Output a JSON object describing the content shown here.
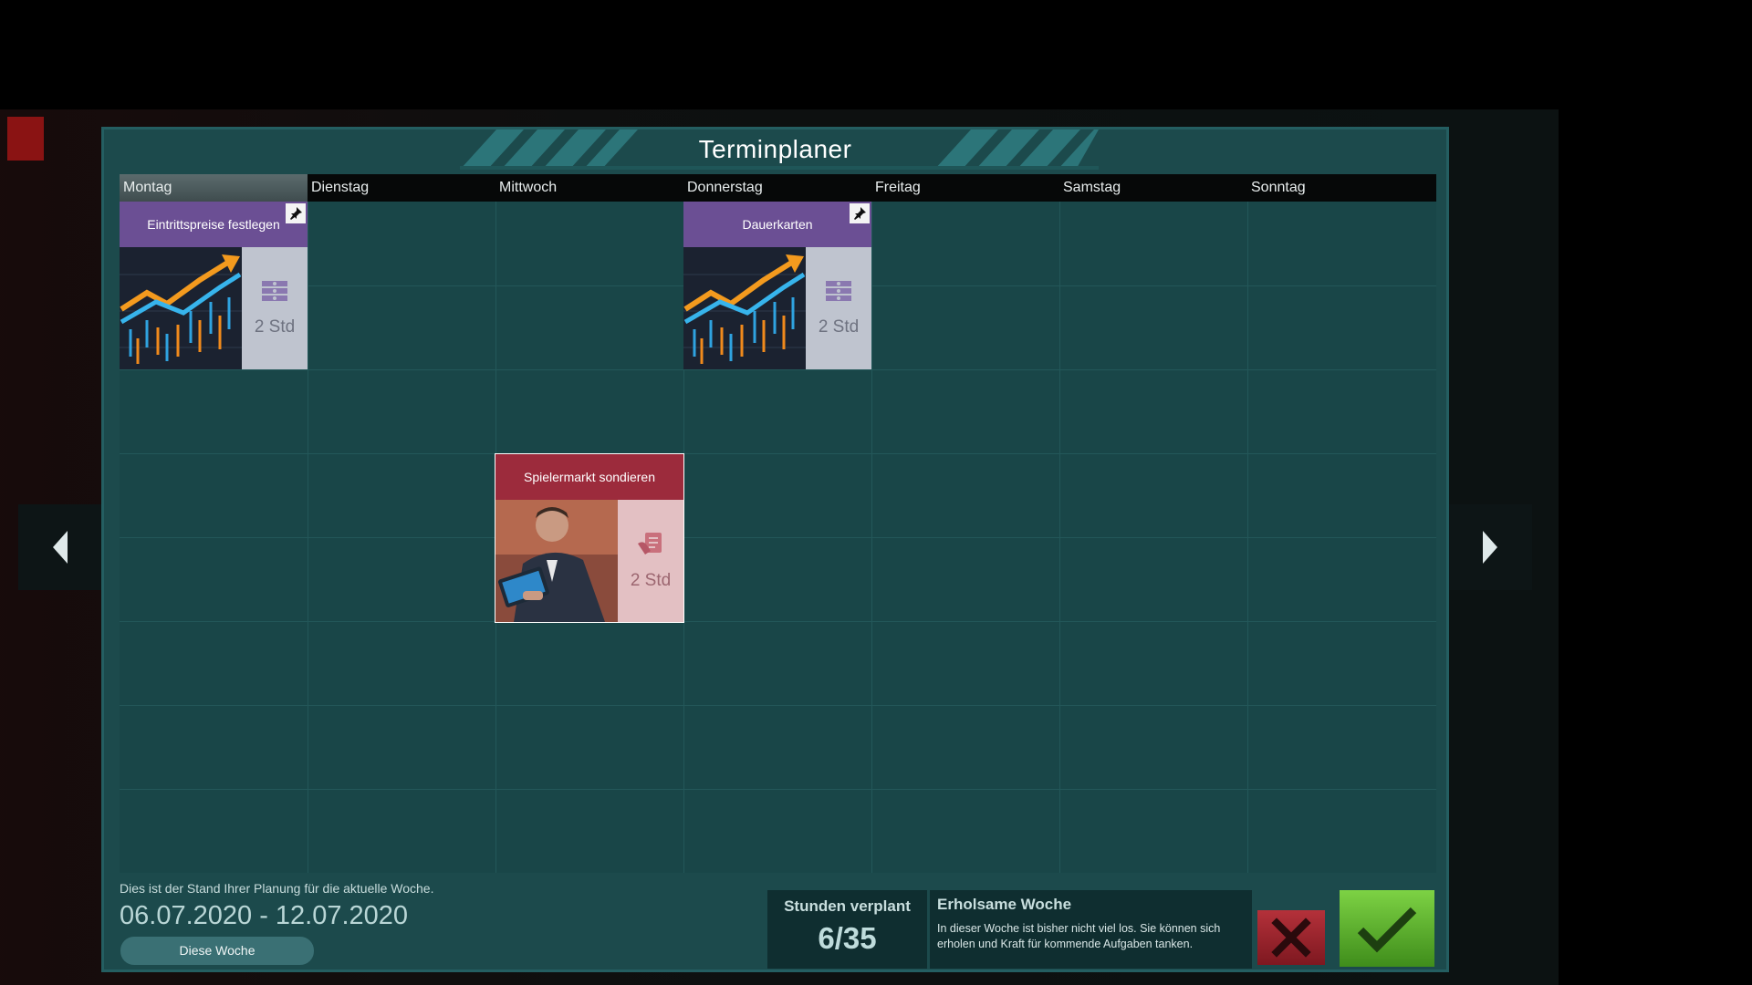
{
  "dialog": {
    "title": "Terminplaner",
    "days": [
      "Montag",
      "Dienstag",
      "Mittwoch",
      "Donnerstag",
      "Freitag",
      "Samstag",
      "Sonntag"
    ],
    "active_day": "Montag"
  },
  "tasks": [
    {
      "title": "Eintrittspreise festlegen",
      "day": "Montag",
      "hours_label": "2 Std",
      "category_icon": "money-stack-icon",
      "image": "stock-chart-image",
      "pinned": true,
      "color": "#6b4f94"
    },
    {
      "title": "Dauerkarten",
      "day": "Donnerstag",
      "hours_label": "2 Std",
      "category_icon": "money-stack-icon",
      "image": "stock-chart-image",
      "pinned": true,
      "color": "#6b4f94"
    },
    {
      "title": "Spielermarkt sondieren",
      "day": "Mittwoch",
      "hours_label": "2 Std",
      "category_icon": "contract-hand-icon",
      "image": "businessman-tablet-image",
      "pinned": false,
      "selected": true,
      "color": "#9c2b3c"
    }
  ],
  "footer": {
    "note": "Dies ist der Stand Ihrer Planung für die aktuelle Woche.",
    "date_range": "06.07.2020 - 12.07.2020",
    "week_button": "Diese Woche",
    "hours_label": "Stunden verplant",
    "hours_value": "6/35",
    "status_title": "Erholsame Woche",
    "status_text": "In dieser Woche ist bisher nicht viel los. Sie können sich erholen und Kraft für kommende Aufgaben tanken."
  },
  "colors": {
    "accent_green": "#5fb52e",
    "cancel_red": "#a5252e",
    "panel": "#1c4a4c"
  }
}
